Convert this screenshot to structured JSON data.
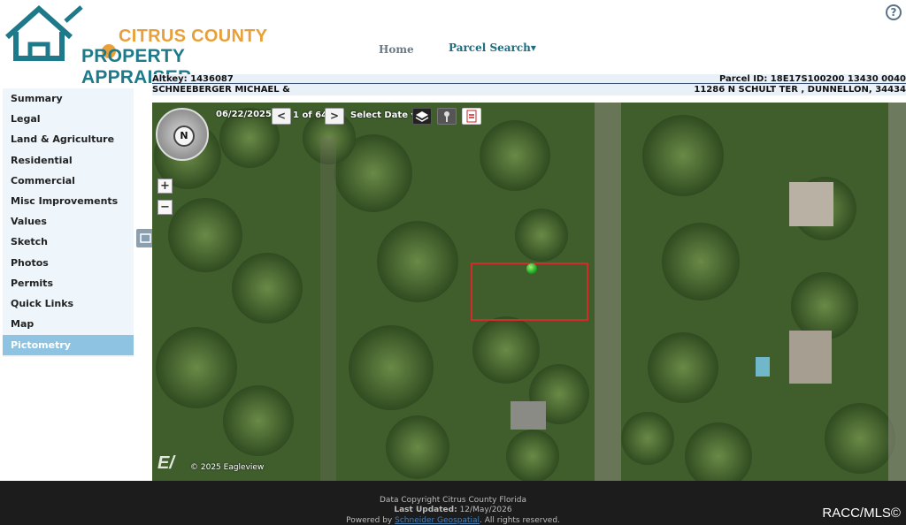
{
  "header": {
    "logo_line1": "CITRUS COUNTY",
    "logo_line2": "PROPERTY APPRAISER",
    "nav_home": "Home",
    "nav_parcel_search": "Parcel Search▾",
    "help_symbol": "?"
  },
  "parcel": {
    "altkey": "Altkey: 1436087",
    "parcel_id": "Parcel ID: 18E17S100200 13430 0040",
    "owner": "SCHNEEBERGER MICHAEL &",
    "address": "11286 N SCHULT TER , DUNNELLON, 34434"
  },
  "sidebar": {
    "items": [
      {
        "label": "Summary"
      },
      {
        "label": "Legal"
      },
      {
        "label": "Land & Agriculture"
      },
      {
        "label": "Residential"
      },
      {
        "label": "Commercial"
      },
      {
        "label": "Misc Improvements"
      },
      {
        "label": "Values"
      },
      {
        "label": "Sketch"
      },
      {
        "label": "Photos"
      },
      {
        "label": "Permits"
      },
      {
        "label": "Quick Links"
      },
      {
        "label": "Map"
      },
      {
        "label": "Pictometry",
        "active": true
      }
    ]
  },
  "map": {
    "date": "06/22/2025",
    "prev_symbol": "<",
    "count": "1 of 64",
    "next_symbol": ">",
    "select_date": "Select Date ▾",
    "compass_label": "N",
    "zoom_in": "+",
    "zoom_out": "−",
    "copyright": "© 2025 Eagleview",
    "ev_logo": "E/"
  },
  "footer": {
    "line1": "Data Copyright Citrus County Florida",
    "last_updated_label": "Last Updated:",
    "last_updated_value": "12/May/2026",
    "powered_by": "Powered by",
    "powered_link": "Schneider Geospatial",
    "rights": ". All rights reserved.",
    "watermark": "RACC/MLS©"
  },
  "colors": {
    "brand_teal": "#1e7a8a",
    "brand_orange": "#e8a13a",
    "active_tab": "#8fc3e2",
    "parcel_outline": "#d42a2a"
  }
}
